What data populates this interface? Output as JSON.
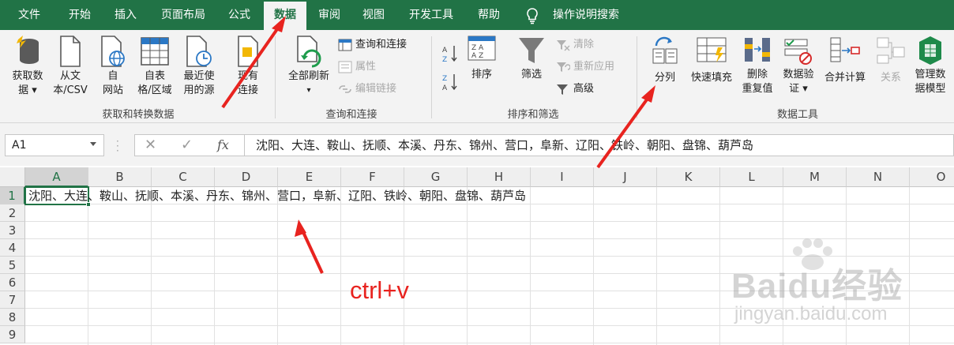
{
  "menu": {
    "tabs": [
      "文件",
      "开始",
      "插入",
      "页面布局",
      "公式",
      "数据",
      "审阅",
      "视图",
      "开发工具",
      "帮助"
    ],
    "active_tab": "数据",
    "tell_me": "操作说明搜索"
  },
  "ribbon": {
    "get_transform": {
      "get_data": "获取数\n据 ▾",
      "from_text": "从文\n本/CSV",
      "from_web": "自\n网站",
      "from_table": "自表\n格/区域",
      "recent_sources": "最近使\n用的源",
      "existing_connections": "现有\n连接",
      "group_label": "获取和转换数据"
    },
    "queries": {
      "refresh_all": "全部刷新",
      "queries_connections": "查询和连接",
      "properties": "属性",
      "edit_links": "编辑链接",
      "group_label": "查询和连接"
    },
    "sort_filter": {
      "sort": "排序",
      "filter": "筛选",
      "clear": "清除",
      "reapply": "重新应用",
      "advanced": "高级",
      "group_label": "排序和筛选"
    },
    "data_tools": {
      "text_to_columns": "分列",
      "flash_fill": "快速填充",
      "remove_duplicates": "删除\n重复值",
      "data_validation": "数据验\n证 ▾",
      "consolidate": "合并计算",
      "relationships": "关系",
      "data_model": "管理数\n据模型",
      "group_label": "数据工具"
    }
  },
  "formula_bar": {
    "name_box": "A1",
    "cancel_glyph": "✕",
    "enter_glyph": "✓",
    "fx_label": "fx",
    "content": "沈阳、大连、鞍山、抚顺、本溪、丹东、锦州、营口，阜新、辽阳、铁岭、朝阳、盘锦、葫芦岛"
  },
  "sheet": {
    "columns": [
      "A",
      "B",
      "C",
      "D",
      "E",
      "F",
      "G",
      "H",
      "I",
      "J",
      "K",
      "L",
      "M",
      "N",
      "O"
    ],
    "rows": [
      "1",
      "2",
      "3",
      "4",
      "5",
      "6",
      "7",
      "8",
      "9"
    ],
    "selected_cell": "A1",
    "a1_value": "沈阳、大连、鞍山、抚顺、本溪、丹东、锦州、营口，阜新、辽阳、铁岭、朝阳、盘锦、葫芦岛"
  },
  "annotation": {
    "text": "ctrl+v",
    "color": "#e8231f"
  },
  "watermark": {
    "brand": "Baidu经验",
    "url": "jingyan.baidu.com"
  },
  "colors": {
    "excel_green": "#217346",
    "ribbon_bg": "#f3f3f3",
    "arrow_red": "#e8231f"
  }
}
